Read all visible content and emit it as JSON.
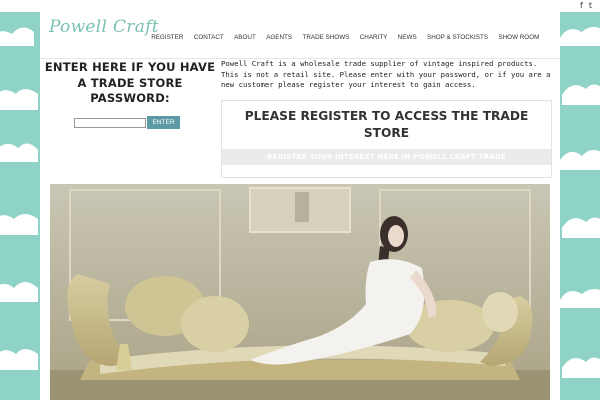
{
  "social": {
    "facebook": "f",
    "twitter": "t"
  },
  "header": {
    "logo": "Powell Craft",
    "nav": [
      "REGISTER",
      "CONTACT",
      "ABOUT",
      "AGENTS",
      "TRADE SHOWS",
      "CHARITY",
      "NEWS",
      "SHOP & STOCKISTS",
      "SHOW ROOM"
    ]
  },
  "login": {
    "title": "ENTER HERE IF YOU HAVE A TRADE STORE PASSWORD:",
    "password_value": "",
    "button": "ENTER"
  },
  "info": {
    "text": "Powell Craft is a wholesale trade supplier of vintage inspired products. This is not a retail site. Please enter with your password, or if you are a new customer please register your interest to gain access."
  },
  "register_box": {
    "heading": "PLEASE REGISTER TO ACCESS THE TRADE STORE",
    "link": "REGISTER YOUR INTEREST HERE IN POWELL CRAFT TRADE"
  },
  "colors": {
    "accent": "#79c1b4",
    "background_teal": "#8fd3c6",
    "button": "#5c9aa6"
  }
}
